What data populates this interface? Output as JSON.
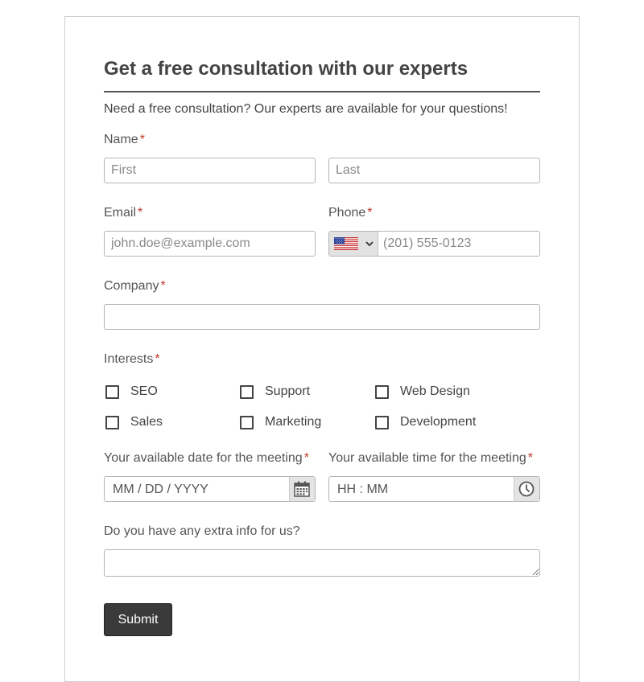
{
  "form": {
    "title": "Get a free consultation with our experts",
    "description": "Need a free consultation? Our experts are available for your questions!",
    "required_mark": "*",
    "name": {
      "label": "Name",
      "first_placeholder": "First",
      "last_placeholder": "Last"
    },
    "email": {
      "label": "Email",
      "placeholder": "john.doe@example.com"
    },
    "phone": {
      "label": "Phone",
      "country_flag": "us-flag-icon",
      "placeholder": "(201) 555-0123"
    },
    "company": {
      "label": "Company",
      "placeholder": ""
    },
    "interests": {
      "label": "Interests",
      "options": [
        "SEO",
        "Support",
        "Web Design",
        "Sales",
        "Marketing",
        "Development"
      ]
    },
    "date": {
      "label": "Your available date for the meeting",
      "placeholder": "MM / DD / YYYY",
      "icon": "calendar-icon"
    },
    "time": {
      "label": "Your available time for the meeting",
      "placeholder": "HH : MM",
      "icon": "clock-icon"
    },
    "extra": {
      "label": "Do you have any extra info for us?",
      "placeholder": ""
    },
    "submit_label": "Submit"
  },
  "colors": {
    "required": "#c0392b",
    "submit_bg": "#3a3a3a",
    "border": "#b5b5b5"
  }
}
